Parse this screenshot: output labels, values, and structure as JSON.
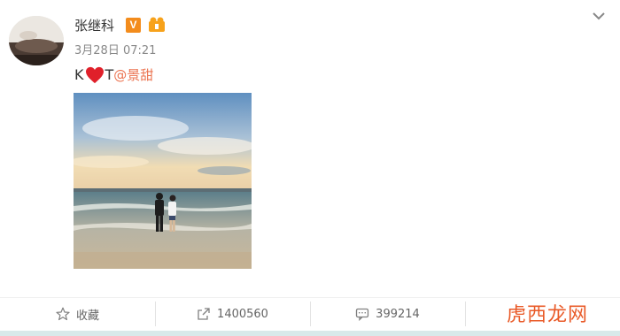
{
  "post": {
    "username": "张继科",
    "verified_mark": "V",
    "timestamp": "3月28日 07:21",
    "text_before": "K",
    "text_after": "T",
    "mention": "@景甜",
    "mention_color": "#eb7350",
    "icons": [
      "verified-icon",
      "badge-icon",
      "heart-icon",
      "chevron-down-icon"
    ]
  },
  "actions": {
    "favorite_label": "收藏",
    "repost_count": "1400560",
    "comment_count": "399214",
    "like_count": ""
  },
  "watermark": "虎西龙网",
  "colors": {
    "accent": "#eb7350",
    "verified": "#f38c1c",
    "heart": "#e0202a"
  }
}
